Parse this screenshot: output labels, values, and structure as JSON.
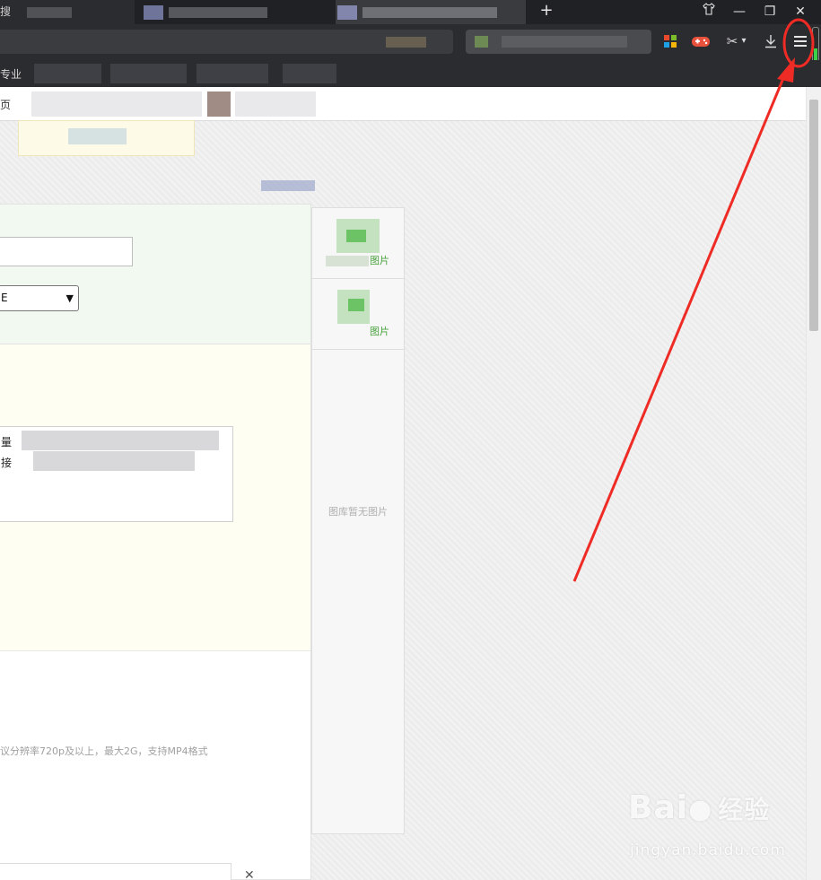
{
  "browser": {
    "tab_text": "搜",
    "new_tab": "+",
    "window_controls": {
      "skin": "shirt-icon",
      "minimize": "—",
      "restore": "❐",
      "close": "✕"
    },
    "toolbar": {
      "download_icon": "⤓",
      "scissors_icon": "✂",
      "dropdown_icon": "▾"
    },
    "bookmarks": {
      "first_label": "专业"
    }
  },
  "page": {
    "breadcrumb": "页",
    "form": {
      "select_value": "E",
      "hint_text": "议分辨率720p及以上，最大2G，支持MP4格式",
      "textarea_lines": [
        "量",
        "接"
      ],
      "close_mark": "✕"
    },
    "side_panel": {
      "item1_label": "图片",
      "item2_label": "图片",
      "empty_text": "图库暂无图片"
    }
  },
  "watermark": {
    "logo": "Bai",
    "logo_tail": "经验",
    "url": "jingyan.baidu.com"
  },
  "colors": {
    "annotation_red": "#ee2b24",
    "accent_green": "#4aa23f",
    "browser_dark": "#202124"
  }
}
